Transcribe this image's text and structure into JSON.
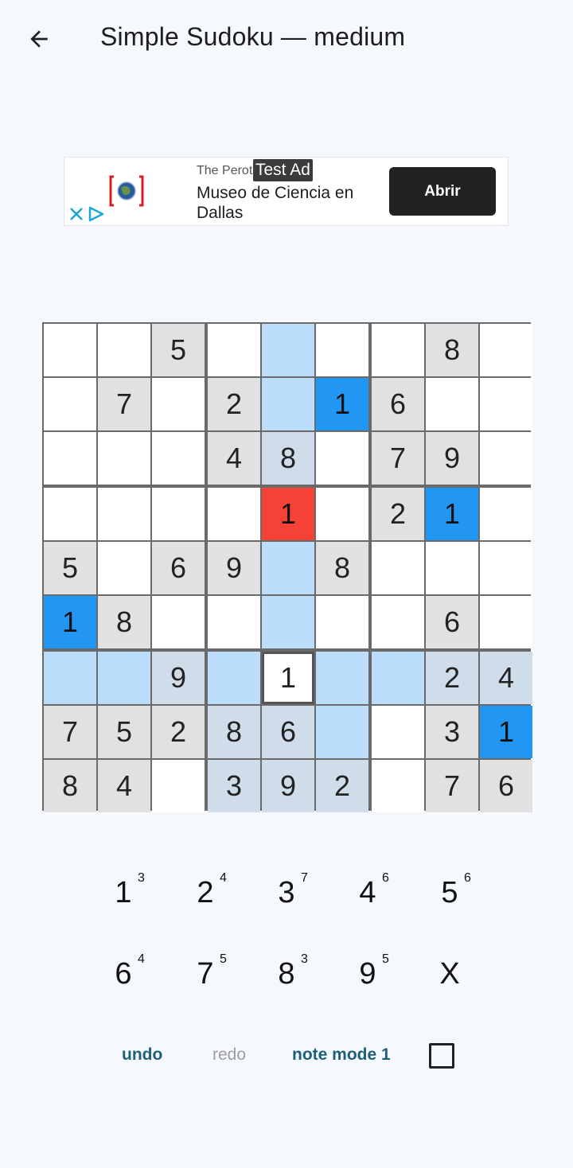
{
  "appbar": {
    "title": "Simple Sudoku — medium"
  },
  "ad": {
    "advertiser": "The Perot",
    "badge": "Test Ad",
    "headline": "Museo de Ciencia en Dallas",
    "cta": "Abrir"
  },
  "board": {
    "rows": [
      [
        "",
        "",
        "5",
        "",
        "",
        "",
        "",
        "8",
        ""
      ],
      [
        "",
        "7",
        "",
        "2",
        "",
        "1",
        "6",
        "",
        ""
      ],
      [
        "",
        "",
        "",
        "4",
        "8",
        "",
        "7",
        "9",
        ""
      ],
      [
        "",
        "",
        "",
        "",
        "1",
        "",
        "2",
        "1",
        ""
      ],
      [
        "5",
        "",
        "6",
        "9",
        "",
        "8",
        "",
        "",
        ""
      ],
      [
        "1",
        "8",
        "",
        "",
        "",
        "",
        "",
        "6",
        ""
      ],
      [
        "",
        "",
        "9",
        "",
        "1",
        "",
        "",
        "2",
        "4"
      ],
      [
        "7",
        "5",
        "2",
        "8",
        "6",
        "",
        "",
        "3",
        "1"
      ],
      [
        "8",
        "4",
        "",
        "3",
        "9",
        "2",
        "",
        "7",
        "6"
      ]
    ],
    "states": [
      [
        "",
        "",
        "given",
        "",
        "hl",
        "",
        "",
        "given",
        ""
      ],
      [
        "",
        "given",
        "",
        "given",
        "hl",
        "same",
        "given",
        "",
        ""
      ],
      [
        "",
        "",
        "",
        "given",
        "hl-given",
        "",
        "given",
        "given",
        ""
      ],
      [
        "",
        "",
        "",
        "",
        "conflict",
        "",
        "given",
        "same",
        ""
      ],
      [
        "given",
        "",
        "given",
        "given",
        "hl",
        "given",
        "",
        "",
        ""
      ],
      [
        "same",
        "given",
        "",
        "",
        "hl",
        "",
        "",
        "given",
        ""
      ],
      [
        "hl",
        "hl",
        "hl-given",
        "hl",
        "selected",
        "hl",
        "hl",
        "hl-given",
        "hl-given"
      ],
      [
        "given",
        "given",
        "given",
        "hl-given",
        "hl-given",
        "hl",
        "",
        "given",
        "same"
      ],
      [
        "given",
        "given",
        "",
        "hl-given",
        "hl-given",
        "hl-given",
        "",
        "given",
        "given"
      ]
    ]
  },
  "keypad": [
    {
      "digit": "1",
      "count": "3"
    },
    {
      "digit": "2",
      "count": "4"
    },
    {
      "digit": "3",
      "count": "7"
    },
    {
      "digit": "4",
      "count": "6"
    },
    {
      "digit": "5",
      "count": "6"
    },
    {
      "digit": "6",
      "count": "4"
    },
    {
      "digit": "7",
      "count": "5"
    },
    {
      "digit": "8",
      "count": "3"
    },
    {
      "digit": "9",
      "count": "5"
    },
    {
      "digit": "X",
      "count": ""
    }
  ],
  "actions": {
    "undo": "undo",
    "redo": "redo",
    "note_mode": "note mode 1"
  },
  "colors": {
    "action_enabled": "#1f5f7a",
    "action_disabled": "#9e9e9e",
    "same_number": "#2196f3",
    "conflict": "#f44336",
    "highlight": "#bbdcfb"
  }
}
